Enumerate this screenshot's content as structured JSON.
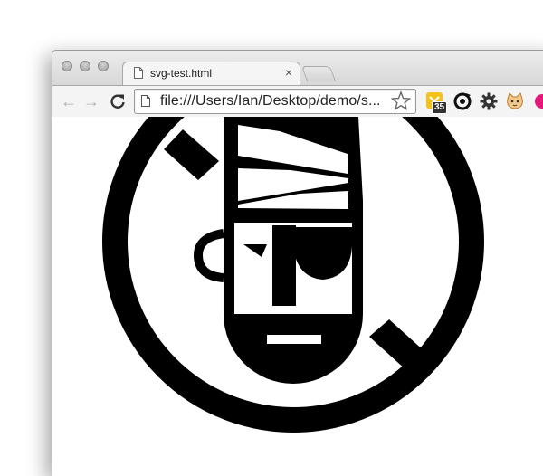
{
  "window": {
    "buttons": [
      "close-window",
      "minimize-window",
      "zoom-window"
    ]
  },
  "tab": {
    "title": "svg-test.html",
    "close": "×"
  },
  "toolbar": {
    "back": "←",
    "forward": "→",
    "url": "file:///Users/Ian/Desktop/demo/s..."
  },
  "extensions": {
    "badge_count": "35"
  },
  "icons": [
    "document-icon",
    "back-arrow-icon",
    "forward-arrow-icon",
    "reload-icon",
    "bookmark-star-icon",
    "extension-icon",
    "sync-icon",
    "wrench-gear-icon",
    "cat-face-icon",
    "pink-extension-icon"
  ],
  "colors": {
    "art": "#000000",
    "background": "#ffffff",
    "ext_yellow": "#f4c21b",
    "ext_pink": "#e4177b"
  }
}
